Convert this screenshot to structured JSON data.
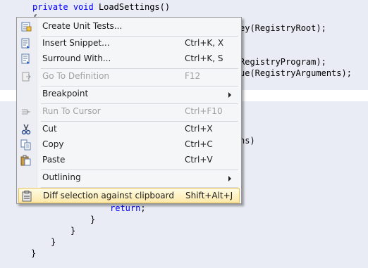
{
  "code": {
    "line1": {
      "kw1": "private",
      "kw2": "void",
      "rest": " LoadSettings()"
    },
    "line2": "{",
    "line3": "ey(RegistryRoot);",
    "line4": "RegistryProgram);",
    "line5": "ue(RegistryArguments);",
    "line6": "ns)",
    "line7_kw": "return",
    "line7_rest": ";",
    "brace": "}"
  },
  "menu": {
    "items": [
      {
        "label": "Create Unit Tests...",
        "shortcut": "",
        "icon": "unit-test-icon"
      },
      {
        "label": "Insert Snippet...",
        "shortcut": "Ctrl+K, X",
        "icon": "insert-snippet-icon"
      },
      {
        "label": "Surround With...",
        "shortcut": "Ctrl+K, S",
        "icon": "surround-with-icon"
      },
      {
        "label": "Go To Definition",
        "shortcut": "F12",
        "icon": "go-to-definition-icon",
        "disabled": true
      },
      {
        "label": "Breakpoint",
        "shortcut": "",
        "submenu": true
      },
      {
        "label": "Run To Cursor",
        "shortcut": "Ctrl+F10",
        "icon": "run-to-cursor-icon",
        "disabled": true
      },
      {
        "label": "Cut",
        "shortcut": "Ctrl+X",
        "icon": "scissors-icon"
      },
      {
        "label": "Copy",
        "shortcut": "Ctrl+C",
        "icon": "copy-icon"
      },
      {
        "label": "Paste",
        "shortcut": "Ctrl+V",
        "icon": "paste-icon"
      },
      {
        "label": "Outlining",
        "shortcut": "",
        "submenu": true
      },
      {
        "label": "Diff selection against clipboard",
        "shortcut": "Shift+Alt+J",
        "icon": "diff-clipboard-icon",
        "highlighted": true
      }
    ]
  },
  "colors": {
    "keyword": "#0000ff",
    "selection": "#eaecf5",
    "highlight_border": "#e6c25a"
  }
}
